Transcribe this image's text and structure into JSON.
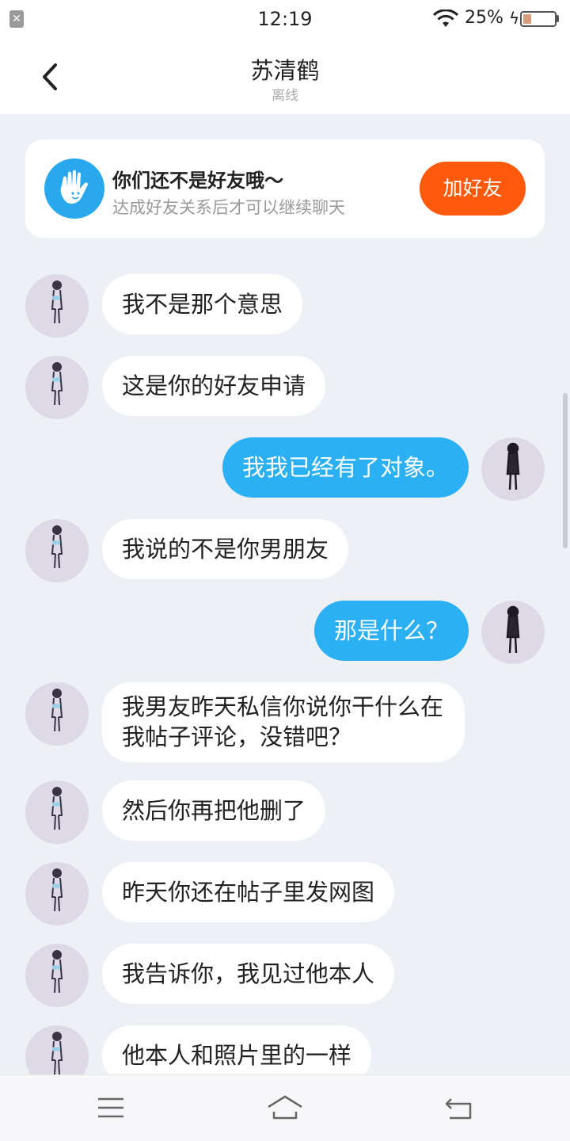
{
  "status_bar": {
    "time": "12:19",
    "battery_percent": "25%",
    "battery_level": 0.25
  },
  "header": {
    "title": "苏清鹤",
    "subtitle": "离线",
    "back_icon": "chevron-left-icon"
  },
  "friend_notice": {
    "title": "你们还不是好友哦～",
    "subtitle": "达成好友关系后才可以继续聊天",
    "button_label": "加好友",
    "icon": "hand-icon",
    "accent_color": "#ff5a0c"
  },
  "messages": [
    {
      "sender": "other",
      "text": "我不是那个意思"
    },
    {
      "sender": "other",
      "text": "这是你的好友申请"
    },
    {
      "sender": "me",
      "text": "我我已经有了对象。"
    },
    {
      "sender": "other",
      "text": "我说的不是你男朋友"
    },
    {
      "sender": "me",
      "text": "那是什么？"
    },
    {
      "sender": "other",
      "text": "我男友昨天私信你说你干什么在我帖子评论，没错吧？"
    },
    {
      "sender": "other",
      "text": "然后你再把他删了"
    },
    {
      "sender": "other",
      "text": "昨天你还在帖子里发网图"
    },
    {
      "sender": "other",
      "text": "我告诉你，我见过他本人"
    },
    {
      "sender": "other",
      "text": "他本人和照片里的一样"
    }
  ],
  "bottom_nav": {
    "icons": [
      "menu-icon",
      "home-icon",
      "back-return-icon"
    ]
  },
  "colors": {
    "outgoing_bubble": "#2cb0f4",
    "incoming_bubble": "#ffffff",
    "background": "#edf0f5"
  }
}
